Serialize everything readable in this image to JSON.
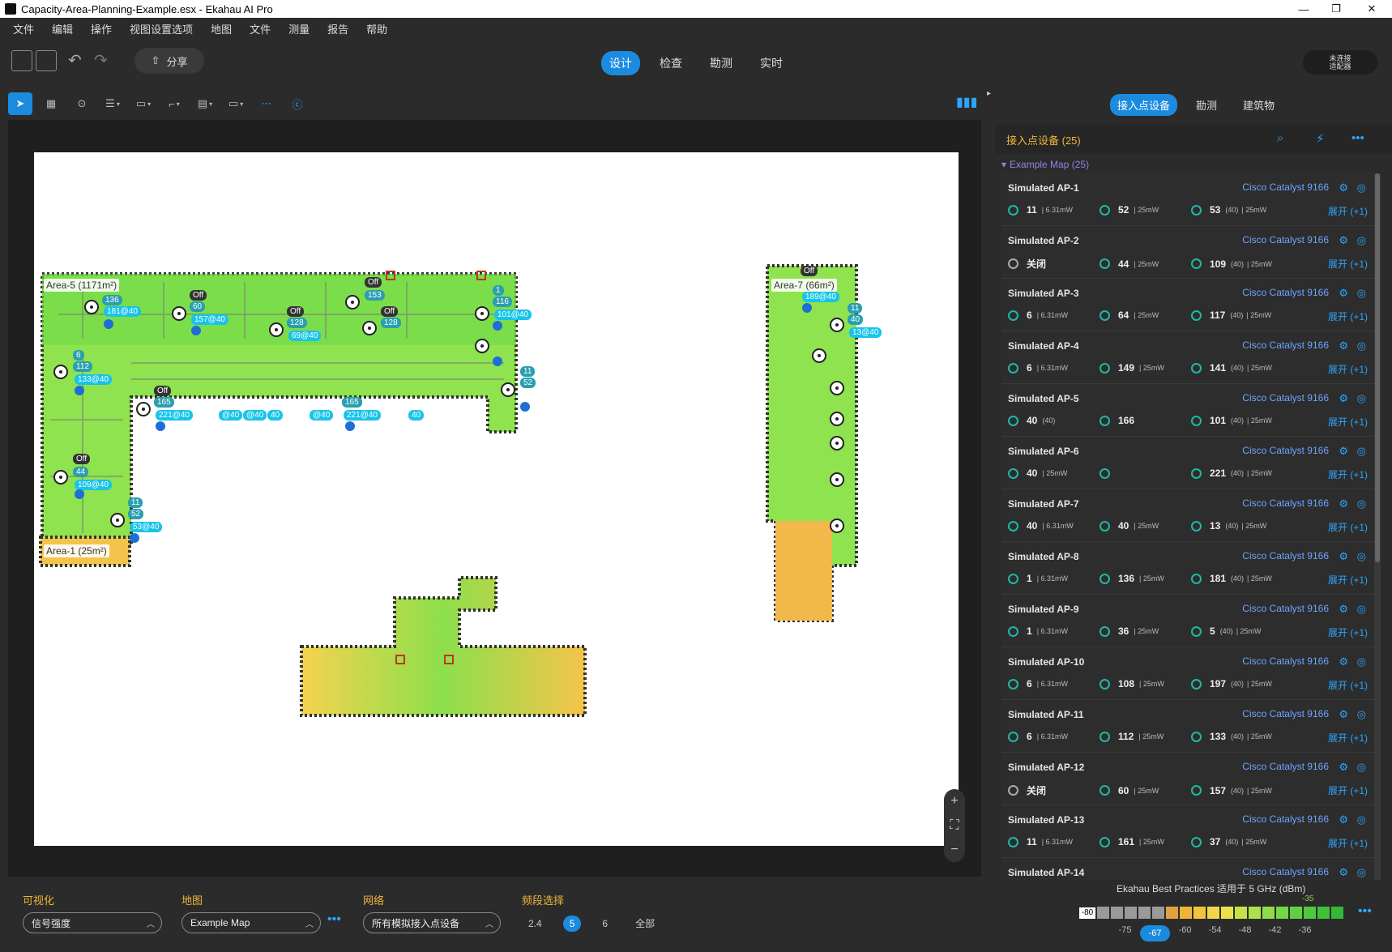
{
  "window": {
    "title": "Capacity-Area-Planning-Example.esx - Ekahau AI Pro",
    "minimize": "—",
    "maximize": "❐",
    "close": "✕"
  },
  "menu": [
    "文件",
    "编辑",
    "操作",
    "视图设置选项",
    "地图",
    "文件",
    "测量",
    "报告",
    "帮助"
  ],
  "toolbar": {
    "share_label": "分享",
    "modes": [
      "设计",
      "检查",
      "勘测",
      "实时"
    ],
    "active_mode": "设计",
    "adapter_label_line1": "未连接",
    "adapter_label_line2": "适配器"
  },
  "tools": [
    "select",
    "measure",
    "ap-place",
    "wall",
    "area",
    "shape",
    "floor",
    "comment",
    "capacity",
    "channel"
  ],
  "map": {
    "areas": [
      {
        "label": "Area-5 (1171m²)"
      },
      {
        "label": "Area-7 (66m²)"
      },
      {
        "label": "Area-1 (25m²)"
      }
    ],
    "badges": [
      "136",
      "181@40",
      "60",
      "157@40",
      "128",
      "69@40",
      "153",
      "128",
      "1",
      "116",
      "101@40",
      "6",
      "112",
      "133@40",
      "165",
      "221@40",
      "@40",
      "@40",
      "40",
      "@40",
      "165",
      "221@40",
      "40",
      "44",
      "109@40",
      "11",
      "52",
      "53@40",
      "11",
      "52",
      "189@40",
      "11",
      "40",
      "13@40"
    ],
    "off_label": "Off"
  },
  "right_panel": {
    "tabs": [
      "接入点设备",
      "勘测",
      "建筑物"
    ],
    "active_tab": "接入点设备",
    "header": "接入点设备 (25)",
    "group": "Example Map (25)",
    "aps": [
      {
        "name": "Simulated AP-1",
        "model": "Cisco Catalyst 9166",
        "r1": "11",
        "r1pw": "| 6.31mW",
        "r2": "52",
        "r2pw": "| 25mW",
        "r3": "53",
        "r3w": "(40)",
        "r3pw": "| 25mW",
        "expand": "展开 (+1)"
      },
      {
        "name": "Simulated AP-2",
        "model": "Cisco Catalyst 9166",
        "r1": "关闭",
        "r1pw": "",
        "r2": "44",
        "r2pw": "| 25mW",
        "r3": "109",
        "r3w": "(40)",
        "r3pw": "| 25mW",
        "expand": "展开 (+1)"
      },
      {
        "name": "Simulated AP-3",
        "model": "Cisco Catalyst 9166",
        "r1": "6",
        "r1pw": "| 6.31mW",
        "r2": "64",
        "r2pw": "| 25mW",
        "r3": "117",
        "r3w": "(40)",
        "r3pw": "| 25mW",
        "expand": "展开 (+1)"
      },
      {
        "name": "Simulated AP-4",
        "model": "Cisco Catalyst 9166",
        "r1": "6",
        "r1pw": "| 6.31mW",
        "r2": "149",
        "r2pw": "| 25mW",
        "r3": "141",
        "r3w": "(40)",
        "r3pw": "| 25mW",
        "expand": "展开 (+1)"
      },
      {
        "name": "Simulated AP-5",
        "model": "Cisco Catalyst 9166",
        "r1": "40",
        "r1pw": "(40)",
        "r2": "166",
        "r2pw": "",
        "r3": "101",
        "r3w": "(40)",
        "r3pw": "| 25mW",
        "expand": "展开 (+1)"
      },
      {
        "name": "Simulated AP-6",
        "model": "Cisco Catalyst 9166",
        "r1": "40",
        "r1pw": "| 25mW",
        "r2": "",
        "r2pw": "",
        "r3": "221",
        "r3w": "(40)",
        "r3pw": "| 25mW",
        "expand": "展开 (+1)"
      },
      {
        "name": "Simulated AP-7",
        "model": "Cisco Catalyst 9166",
        "r1": "40",
        "r1pw": "| 6.31mW",
        "r2": "40",
        "r2pw": "| 25mW",
        "r3": "13",
        "r3w": "(40)",
        "r3pw": "| 25mW",
        "expand": "展开 (+1)"
      },
      {
        "name": "Simulated AP-8",
        "model": "Cisco Catalyst 9166",
        "r1": "1",
        "r1pw": "| 6.31mW",
        "r2": "136",
        "r2pw": "| 25mW",
        "r3": "181",
        "r3w": "(40)",
        "r3pw": "| 25mW",
        "expand": "展开 (+1)"
      },
      {
        "name": "Simulated AP-9",
        "model": "Cisco Catalyst 9166",
        "r1": "1",
        "r1pw": "| 6.31mW",
        "r2": "36",
        "r2pw": "| 25mW",
        "r3": "5",
        "r3w": "(40)",
        "r3pw": "| 25mW",
        "expand": "展开 (+1)"
      },
      {
        "name": "Simulated AP-10",
        "model": "Cisco Catalyst 9166",
        "r1": "6",
        "r1pw": "| 6.31mW",
        "r2": "108",
        "r2pw": "| 25mW",
        "r3": "197",
        "r3w": "(40)",
        "r3pw": "| 25mW",
        "expand": "展开 (+1)"
      },
      {
        "name": "Simulated AP-11",
        "model": "Cisco Catalyst 9166",
        "r1": "6",
        "r1pw": "| 6.31mW",
        "r2": "112",
        "r2pw": "| 25mW",
        "r3": "133",
        "r3w": "(40)",
        "r3pw": "| 25mW",
        "expand": "展开 (+1)"
      },
      {
        "name": "Simulated AP-12",
        "model": "Cisco Catalyst 9166",
        "r1": "关闭",
        "r1pw": "",
        "r2": "60",
        "r2pw": "| 25mW",
        "r3": "157",
        "r3w": "(40)",
        "r3pw": "| 25mW",
        "expand": "展开 (+1)"
      },
      {
        "name": "Simulated AP-13",
        "model": "Cisco Catalyst 9166",
        "r1": "11",
        "r1pw": "| 6.31mW",
        "r2": "161",
        "r2pw": "| 25mW",
        "r3": "37",
        "r3w": "(40)",
        "r3pw": "| 25mW",
        "expand": "展开 (+1)"
      },
      {
        "name": "Simulated AP-14",
        "model": "Cisco Catalyst 9166",
        "r1": "",
        "r1pw": "",
        "r2": "",
        "r2pw": "",
        "r3": "",
        "r3w": "",
        "r3pw": "",
        "expand": ""
      }
    ]
  },
  "bottom": {
    "visualization_label": "可视化",
    "visualization_value": "信号强度",
    "map_label": "地图",
    "map_value": "Example Map",
    "network_label": "网络",
    "network_value": "所有模拟接入点设备",
    "band_label": "频段选择",
    "bands": [
      "2.4",
      "5",
      "6",
      "全部"
    ],
    "active_band": "5",
    "legend_title": "Ekahau Best Practices 适用于 5 GHz (dBm)",
    "legend_min": "-80",
    "legend_max": "-35",
    "legend_ticks": [
      "-75",
      "-67",
      "-60",
      "-54",
      "-48",
      "-42",
      "-36"
    ],
    "legend_active_tick": "-67",
    "legend_colors": [
      "#9a9a9a",
      "#9a9a9a",
      "#9a9a9a",
      "#9a9a9a",
      "#9a9a9a",
      "#e1a23c",
      "#f0b43a",
      "#f2c43e",
      "#f4d64a",
      "#e8e34a",
      "#c8e04a",
      "#aee04a",
      "#8fdc48",
      "#74d844",
      "#5fd040",
      "#4fc93d",
      "#3fc13a",
      "#35b838"
    ]
  },
  "colors": {
    "accent": "#1b8be0",
    "orange": "#f0b53a",
    "teal": "#1fb8a6"
  }
}
